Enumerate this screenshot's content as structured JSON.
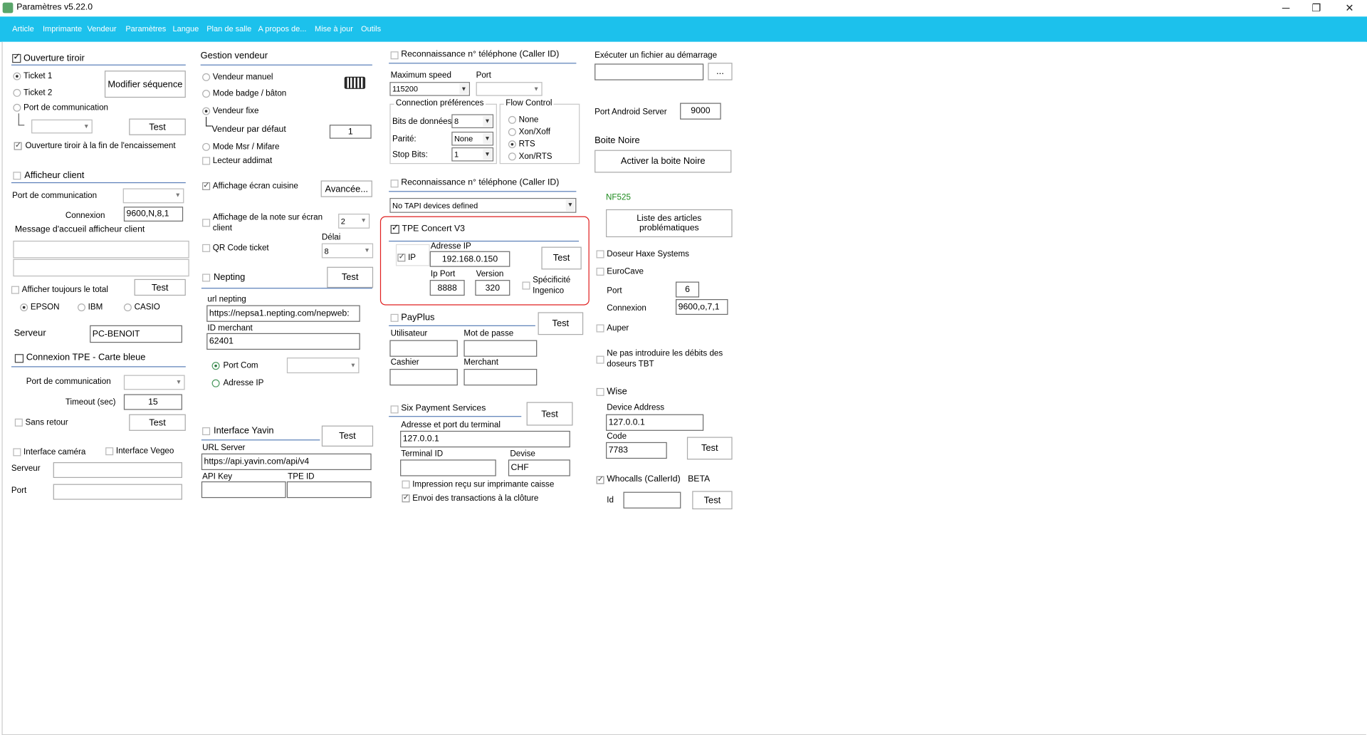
{
  "window": {
    "title": "Paramètres v5.22.0",
    "minimize": "─",
    "maximize": "❐",
    "close": "✕"
  },
  "menu": [
    "Article",
    "Imprimante",
    "Vendeur",
    "Paramètres",
    "Langue",
    "Plan de salle",
    "A propos de...",
    "Mise à jour",
    "Outils"
  ],
  "col1": {
    "tiroir": {
      "title": "Ouverture tiroir",
      "ticket1": "Ticket 1",
      "ticket2": "Ticket 2",
      "port": "Port de communication",
      "modifier": "Modifier séquence",
      "test": "Test",
      "fin_encaissement": "Ouverture tiroir à la fin de l'encaissement"
    },
    "afficheur": {
      "title": "Afficheur client",
      "port": "Port de communication",
      "connexion_label": "Connexion",
      "connexion": "9600,N,8,1",
      "message": "Message d'accueil afficheur client",
      "afficher_total": "Afficher toujours le total",
      "test": "Test",
      "epson": "EPSON",
      "ibm": "IBM",
      "casio": "CASIO"
    },
    "serveur_label": "Serveur",
    "serveur": "PC-BENOIT",
    "tpe": {
      "title": "Connexion TPE - Carte bleue",
      "port": "Port de communication",
      "timeout_label": "Timeout (sec)",
      "timeout": "15",
      "sans_retour": "Sans retour",
      "test": "Test"
    },
    "camera": "Interface caméra",
    "vegeo": "Interface Vegeo",
    "serveur2": "Serveur",
    "port2": "Port"
  },
  "col2": {
    "vendeur": {
      "title": "Gestion vendeur",
      "manuel": "Vendeur manuel",
      "badge": "Mode badge / bâton",
      "fixe": "Vendeur fixe",
      "defaut_label": "Vendeur par défaut",
      "defaut": "1",
      "msr": "Mode Msr / Mifare",
      "addimat": "Lecteur addimat"
    },
    "cuisine": "Affichage écran cuisine",
    "avancee": "Avancée...",
    "note_cuisine": "Affichage de la note sur écran client",
    "note_value": "2",
    "delai_label": "Délai",
    "delai": "8",
    "qr": "QR Code ticket",
    "nepting": {
      "title": "Nepting",
      "test": "Test",
      "url_label": "url nepting",
      "url": "https://nepsa1.nepting.com/nepweb:",
      "merchant_label": "ID merchant",
      "merchant": "62401",
      "port_com": "Port Com",
      "adresse_ip": "Adresse IP"
    },
    "yavin": {
      "title": "Interface Yavin",
      "test": "Test",
      "url_label": "URL Server",
      "url": "https://api.yavin.com/api/v4",
      "api_key": "API Key",
      "tpe_id": "TPE ID"
    }
  },
  "col3": {
    "caller1": {
      "title": "Reconnaissance n° téléphone (Caller ID)",
      "speed_label": "Maximum speed",
      "speed": "115200",
      "port_label": "Port",
      "prefs": "Connection préférences",
      "bits_label": "Bits de données",
      "bits": "8",
      "parite_label": "Parité:",
      "parite": "None",
      "stop_label": "Stop Bits:",
      "stop": "1",
      "flow": "Flow Control",
      "none": "None",
      "xon": "Xon/Xoff",
      "rts": "RTS",
      "xonrts": "Xon/RTS"
    },
    "caller2": {
      "title": "Reconnaissance n° téléphone (Caller ID)",
      "tapi": "No TAPI devices defined"
    },
    "concert": {
      "title": "TPE Concert V3",
      "ip": "IP",
      "adresse_label": "Adresse IP",
      "adresse": "192.168.0.150",
      "test": "Test",
      "port_label": "Ip Port",
      "port": "8888",
      "version_label": "Version",
      "version": "320",
      "specificite": "Spécificité Ingenico"
    },
    "payplus": {
      "title": "PayPlus",
      "test": "Test",
      "utilisateur": "Utilisateur",
      "mdp": "Mot de passe",
      "cashier": "Cashier",
      "merchant": "Merchant"
    },
    "six": {
      "title": "Six Payment Services",
      "test": "Test",
      "adresse_label": "Adresse et port du terminal",
      "adresse": "127.0.0.1",
      "terminal": "Terminal ID",
      "devise_label": "Devise",
      "devise": "CHF",
      "impression": "Impression reçu sur imprimante caisse",
      "envoi": "Envoi des transactions à la clôture"
    }
  },
  "col4": {
    "executer": "Exécuter un fichier au démarrage",
    "browse": "...",
    "android_label": "Port Android Server",
    "android": "9000",
    "boite_title": "Boite Noire",
    "boite_btn": "Activer la boite Noire",
    "nf": "NF525",
    "liste": "Liste des articles problématiques",
    "haxe": "Doseur Haxe Systems",
    "eurocave": "EuroCave",
    "port_label": "Port",
    "port": "6",
    "connexion_label": "Connexion",
    "connexion": "9600,o,7,1",
    "auper": "Auper",
    "tbt": "Ne pas introduire les débits des doseurs TBT",
    "wise": {
      "title": "Wise",
      "device_label": "Device Address",
      "device": "127.0.0.1",
      "code_label": "Code",
      "code": "7783",
      "test": "Test"
    },
    "whocalls": {
      "title": "Whocalls (CallerId)",
      "beta": "BETA",
      "id_label": "Id",
      "test": "Test"
    }
  }
}
